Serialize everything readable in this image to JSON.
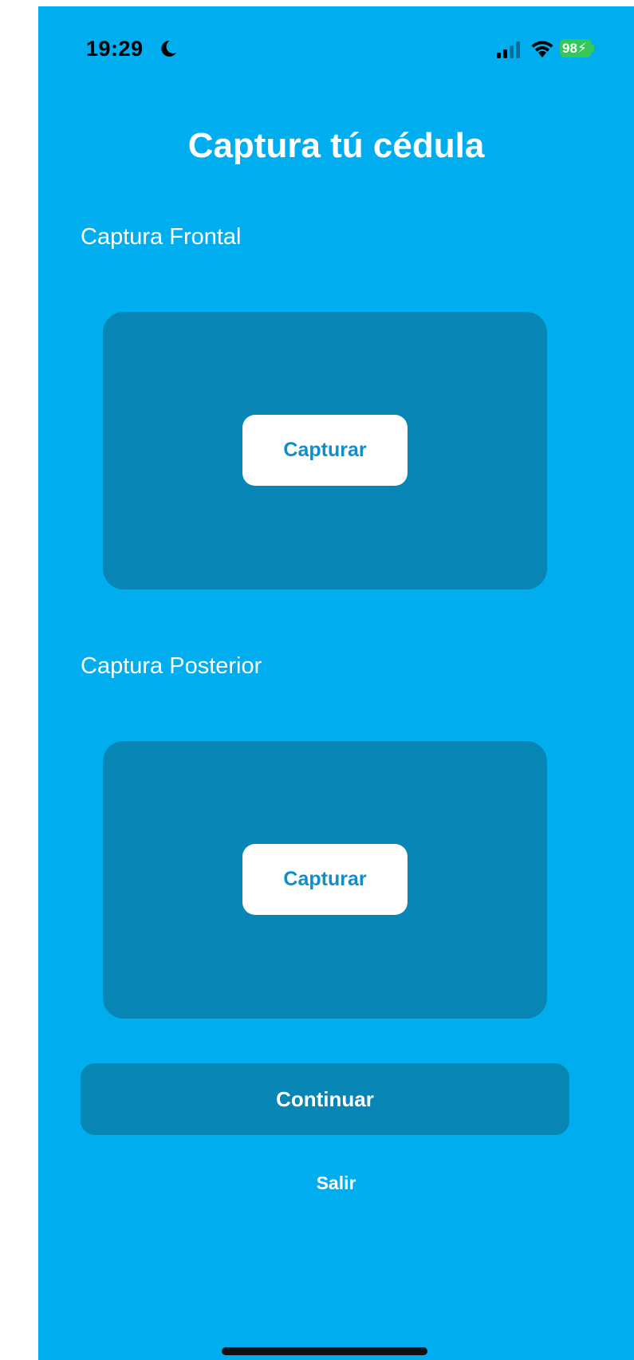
{
  "status_bar": {
    "time": "19:29",
    "battery_level": "98",
    "icons": [
      "moon-icon",
      "cellular-signal-icon",
      "wifi-icon",
      "battery-icon"
    ]
  },
  "page": {
    "title": "Captura tú cédula"
  },
  "front": {
    "label": "Captura Frontal",
    "button_label": "Capturar"
  },
  "back": {
    "label": "Captura Posterior",
    "button_label": "Capturar"
  },
  "actions": {
    "continue_label": "Continuar",
    "exit_label": "Salir"
  },
  "colors": {
    "background": "#00AEEF",
    "card": "#0786B5",
    "button_text": "#0D8FCF",
    "battery": "#34C759"
  }
}
